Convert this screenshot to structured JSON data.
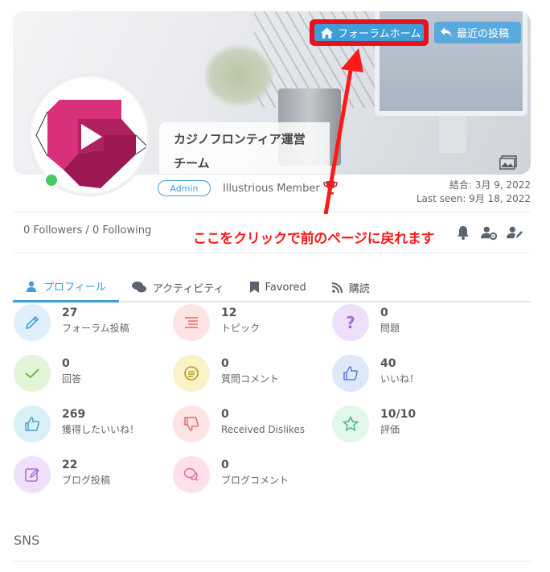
{
  "cover": {
    "forum_home_label": "フォーラムホーム",
    "recent_posts_label": "最近の投稿"
  },
  "profile": {
    "name_line1": "カジノフロンティア運営",
    "name_line2": "チーム",
    "role_badge": "Admin",
    "member_title": "Illustrious Member",
    "joined": "結合: 3月 9, 2022",
    "last_seen": "Last seen: 9月 18, 2022",
    "status": "online"
  },
  "follow": {
    "text": "0 Followers / 0 Following"
  },
  "annotation": {
    "text": "ここをクリックで前のページに戻れます"
  },
  "tabs": [
    {
      "label": "プロフィール",
      "icon": "user-icon",
      "active": true
    },
    {
      "label": "アクティビティ",
      "icon": "comments-icon",
      "active": false
    },
    {
      "label": "Favored",
      "icon": "bookmark-icon",
      "active": false
    },
    {
      "label": "購読",
      "icon": "rss-icon",
      "active": false
    }
  ],
  "stats": [
    {
      "value": "27",
      "label": "フォーラム投稿",
      "icon": "pencil-icon",
      "color": "#dff0fb",
      "icon_color": "#3e9fd8"
    },
    {
      "value": "12",
      "label": "トピック",
      "icon": "list-icon",
      "color": "#fde3e3",
      "icon_color": "#e86a6a"
    },
    {
      "value": "0",
      "label": "問題",
      "icon": "question-icon",
      "color": "#efe0fa",
      "icon_color": "#a86bd8"
    },
    {
      "value": "0",
      "label": "回答",
      "icon": "check-icon",
      "color": "#e3f5d9",
      "icon_color": "#6cbf4a"
    },
    {
      "value": "0",
      "label": "質問コメント",
      "icon": "comment-lines-icon",
      "color": "#fbf1c8",
      "icon_color": "#b39a2b"
    },
    {
      "value": "40",
      "label": "いいね！",
      "icon": "thumbs-up-icon",
      "color": "#dfe7fb",
      "icon_color": "#5a80d8"
    },
    {
      "value": "269",
      "label": "獲得したいいね！",
      "icon": "thumbs-up-icon",
      "color": "#d6f0f6",
      "icon_color": "#4aa3c4"
    },
    {
      "value": "0",
      "label": "Received Dislikes",
      "icon": "thumbs-down-icon",
      "color": "#fde3e3",
      "icon_color": "#e86a6a"
    },
    {
      "value": "10/10",
      "label": "評価",
      "icon": "star-icon",
      "color": "#e2f6ea",
      "icon_color": "#4bb58a"
    },
    {
      "value": "22",
      "label": "ブログ投稿",
      "icon": "pen-square-icon",
      "color": "#efe0fa",
      "icon_color": "#a86bd8"
    },
    {
      "value": "0",
      "label": "ブログコメント",
      "icon": "comments-outline-icon",
      "color": "#fde0ea",
      "icon_color": "#e56a95"
    }
  ],
  "sections": {
    "sns_title": "SNS"
  }
}
